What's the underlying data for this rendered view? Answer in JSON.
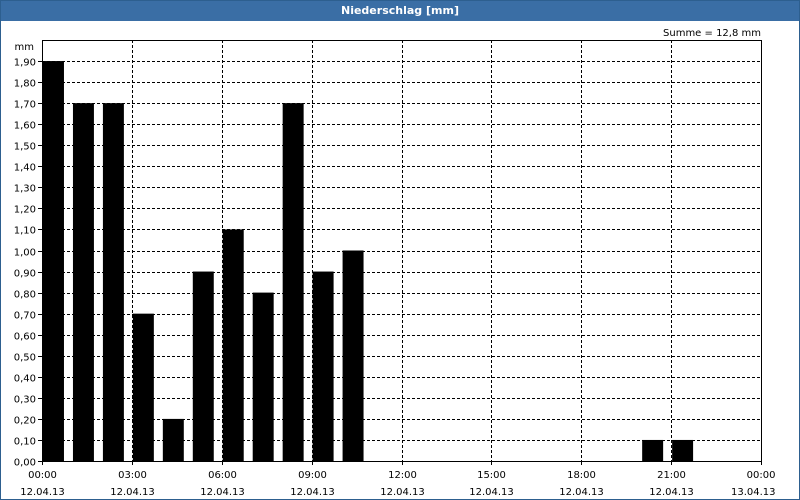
{
  "window": {
    "title": "Niederschlag [mm]"
  },
  "chart_data": {
    "type": "bar",
    "title": "Niederschlag [mm]",
    "ylabel": "mm",
    "summary": "Summe = 12,8 mm",
    "ylim": [
      0,
      2.0
    ],
    "ytick_step": 0.1,
    "grid": true,
    "bar_color": "#000000",
    "x_unit_hours": 24,
    "ytick_labels": [
      "0,00",
      "0,10",
      "0,20",
      "0,30",
      "0,40",
      "0,50",
      "0,60",
      "0,70",
      "0,80",
      "0,90",
      "1,00",
      "1,10",
      "1,20",
      "1,30",
      "1,40",
      "1,50",
      "1,60",
      "1,70",
      "1,80",
      "1,90"
    ],
    "xticks": [
      {
        "hour": 0,
        "time": "00:00",
        "date": "12.04.13"
      },
      {
        "hour": 3,
        "time": "03:00",
        "date": "12.04.13"
      },
      {
        "hour": 6,
        "time": "06:00",
        "date": "12.04.13"
      },
      {
        "hour": 9,
        "time": "09:00",
        "date": "12.04.13"
      },
      {
        "hour": 12,
        "time": "12:00",
        "date": "12.04.13"
      },
      {
        "hour": 15,
        "time": "15:00",
        "date": "12.04.13"
      },
      {
        "hour": 18,
        "time": "18:00",
        "date": "12.04.13"
      },
      {
        "hour": 21,
        "time": "21:00",
        "date": "12.04.13"
      },
      {
        "hour": 24,
        "time": "00:00",
        "date": "13.04.13"
      }
    ],
    "bars": [
      {
        "hour": 0,
        "value": 1.9
      },
      {
        "hour": 1,
        "value": 1.7
      },
      {
        "hour": 2,
        "value": 1.7
      },
      {
        "hour": 3,
        "value": 0.7
      },
      {
        "hour": 4,
        "value": 0.2
      },
      {
        "hour": 5,
        "value": 0.9
      },
      {
        "hour": 6,
        "value": 1.1
      },
      {
        "hour": 7,
        "value": 0.8
      },
      {
        "hour": 8,
        "value": 1.7
      },
      {
        "hour": 9,
        "value": 0.9
      },
      {
        "hour": 10,
        "value": 1.0
      },
      {
        "hour": 20,
        "value": 0.1
      },
      {
        "hour": 21,
        "value": 0.1
      }
    ]
  }
}
